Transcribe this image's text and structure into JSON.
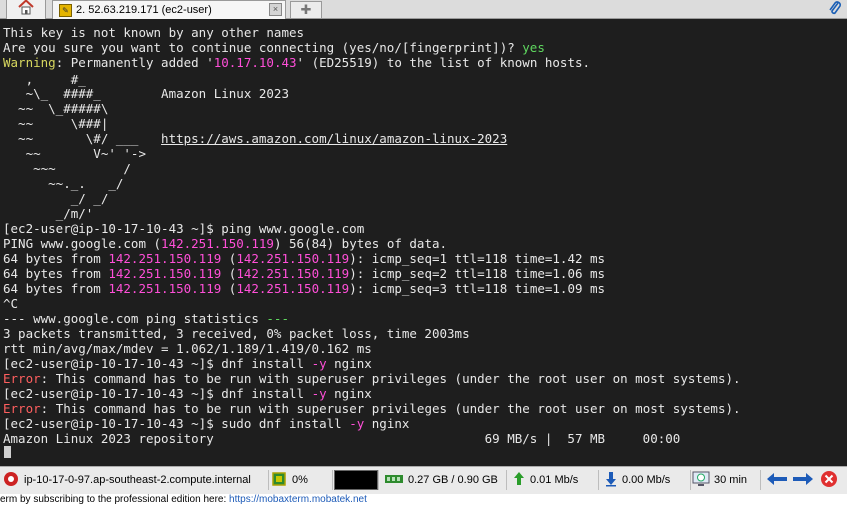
{
  "tabs": {
    "home_icon": "home-icon",
    "session_tab_label": "2. 52.63.219.171 (ec2-user)",
    "new_tab_icon": "plus-icon"
  },
  "terminal": {
    "l1": "This key is not known by any other names",
    "l2_a": "Are you sure you want to continue connecting (yes/no/[fingerprint])? ",
    "l2_b": "yes",
    "l3_a": "Warning",
    "l3_b": ": Permanently added '",
    "l3_c": "10.17.10.43",
    "l3_d": "' (ED25519) to the list of known hosts.",
    "art1": "   ,     #_",
    "art2": "   ~\\_  ####_        Amazon Linux 2023",
    "art3": "  ~~  \\_#####\\",
    "art4": "  ~~     \\###|",
    "art5": "  ~~       \\#/ ___   ",
    "art5_link": "https://aws.amazon.com/linux/amazon-linux-2023",
    "art6": "   ~~       V~' '->",
    "art7": "    ~~~         /",
    "art8": "      ~~._.   _/",
    "art9": "         _/ _/",
    "art10": "       _/m/'",
    "prompt": "[ec2-user@ip-10-17-10-43 ~]$ ",
    "cmd_ping": "ping www.google.com",
    "ping_hdr_a": "PING www.google.com (",
    "ping_ip": "142.251.150.119",
    "ping_hdr_b": ") 56(84) bytes of data.",
    "reply_a": "64 bytes from ",
    "reply_b": " (",
    "reply_c": "): ",
    "seq1": "icmp_seq=1 ttl=118 time=1.42 ms",
    "seq2": "icmp_seq=2 ttl=118 time=1.06 ms",
    "seq3": "icmp_seq=3 ttl=118 time=1.09 ms",
    "ctrl_c": "^C",
    "stats_a": "--- www.google.com ping statistics ",
    "stats_b": "---",
    "stats_line1": "3 packets transmitted, 3 received, 0% packet loss, time 2003ms",
    "stats_line2": "rtt min/avg/max/mdev = 1.062/1.189/1.419/0.162 ms",
    "cmd_dnf_a": "dnf install ",
    "cmd_dnf_flag": "-y",
    "cmd_dnf_b": " nginx",
    "err_label": "Error",
    "err_text": ": This command has to be run with superuser privileges (under the root user on most systems).",
    "cmd_sudo_a": "sudo dnf install ",
    "repo_line": "Amazon Linux 2023 repository                                    69 MB/s |  57 MB     00:00"
  },
  "status": {
    "host": "ip-10-17-0-97.ap-southeast-2.compute.internal",
    "cpu": "0%",
    "memory": "0.27 GB / 0.90 GB",
    "upload": "0.01 Mb/s",
    "download": "0.00 Mb/s",
    "timer": "30 min"
  },
  "footer": {
    "text": "erm by subscribing to the professional edition here:  ",
    "link": "https://mobaxterm.mobatek.net"
  },
  "colors": {
    "terminal_bg": "#1e1e1e",
    "terminal_fg": "#e8e8e8",
    "green": "#5fd75f",
    "yellow": "#d7d75f",
    "magenta": "#ff4fd8",
    "red": "#ff5f5f"
  }
}
